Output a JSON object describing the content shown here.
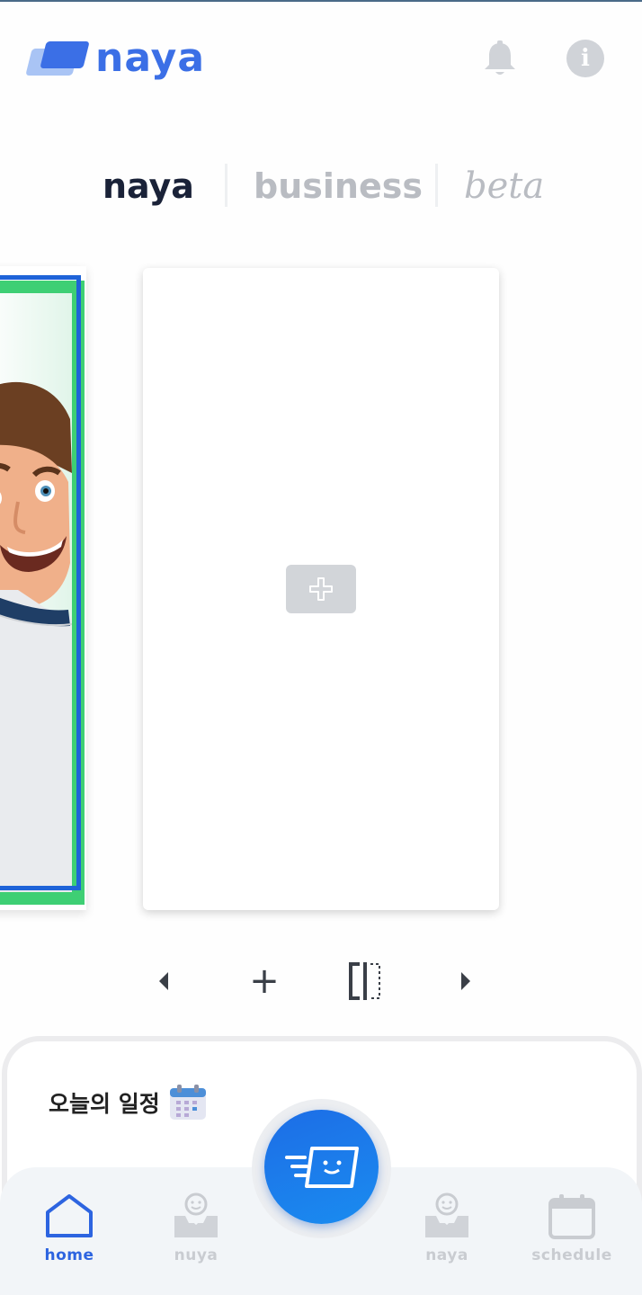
{
  "header": {
    "logo_text": "naya",
    "icons": {
      "notifications": "bell-icon",
      "info": "info-icon"
    }
  },
  "brand_tabs": [
    {
      "label": "naya",
      "active": true
    },
    {
      "label": "business",
      "active": false
    },
    {
      "label": "beta",
      "active": false
    }
  ],
  "carousel": {
    "add_card_icon": "plus-icon",
    "controls": {
      "prev_icon": "caret-left-icon",
      "add_label": "+",
      "split_icon": "split-icon",
      "next_icon": "caret-right-icon"
    }
  },
  "today": {
    "title": "오늘의 일정",
    "emoji": "calendar-icon"
  },
  "bottom_nav": {
    "items": [
      {
        "label": "home",
        "icon": "home-icon",
        "active": true
      },
      {
        "label": "nuya",
        "icon": "inbox-face-icon",
        "active": false
      },
      {
        "label": "naya",
        "icon": "inbox-face-icon",
        "active": false
      },
      {
        "label": "schedule",
        "icon": "calendar-icon",
        "active": false
      }
    ],
    "fab_icon": "send-card-icon"
  },
  "colors": {
    "accent": "#2d64e0",
    "fab": "#1a7aeb",
    "inactive": "#c9ccd1",
    "dark": "#1a2238"
  }
}
